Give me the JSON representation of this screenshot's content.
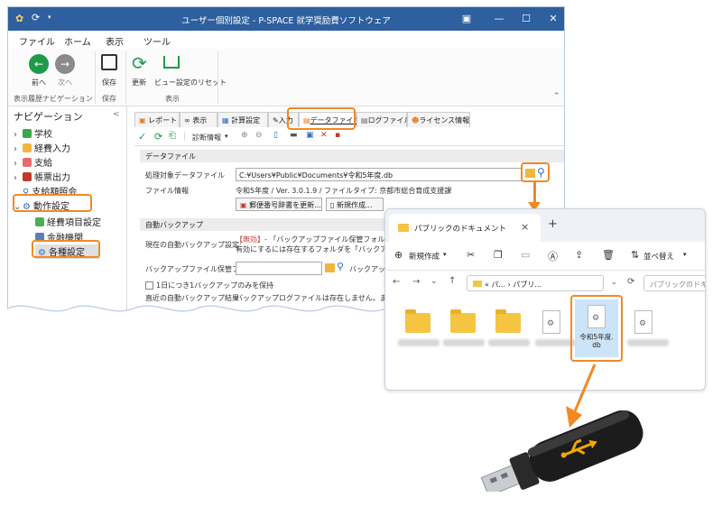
{
  "app": {
    "title": "ユーザー個別設定 - P-SPACE 就学奨励費ソフトウェア",
    "menu": [
      "ファイル",
      "ホーム",
      "表示",
      "ツール"
    ],
    "ribbon": {
      "back": "前へ",
      "forward": "次へ",
      "save": "保存",
      "refresh": "更新",
      "reset_view": "ビュー設定のリセット",
      "group_history": "表示履歴ナビゲーション",
      "group_save": "保存",
      "group_view": "表示"
    },
    "nav": {
      "title": "ナビゲーション",
      "collapse_glyph": "<",
      "items": [
        "学校",
        "経費入力",
        "支給",
        "帳票出力",
        "支給額照会",
        "動作設定",
        "経費項目設定",
        "金融機関",
        "各種設定"
      ]
    },
    "tabs": [
      "レポート",
      "表示",
      "計算設定",
      "入力",
      "データファイル",
      "ログファイル",
      "ライセンス情報"
    ],
    "toolbar": {
      "diagnose": "診断情報"
    },
    "data_section": {
      "header": "データファイル",
      "target_label": "処理対象データファイル",
      "target_path": "C:¥Users¥Public¥Documents¥令和5年度.db",
      "info_label": "ファイル情報",
      "info_value": "令和5年度 / Ver. 3.0.1.9 / ファイルタイプ: 京都市総合育成支援課",
      "btn_postal": "郵便番号辞書を更新...",
      "btn_new": "新規作成..."
    },
    "backup_section": {
      "header": "自動バックアップ",
      "status_label": "現在の自動バックアップ設定:",
      "status_invalid": "【無効】",
      "status_text1": "- 「バックアップファイル保管フォルダ」が存在して",
      "status_text2": "有効にするには存在するフォルダを「バックアップファイル",
      "folder_label": "バックアップファイル保管フォルダ",
      "folder_hint": "バックアップを作",
      "once_daily": "1日につき1バックアップのみを保持",
      "recent_label": "直近の自動バックアップ結果",
      "recent_value": "バックアップログファイルは存在しません。まだ一度もバッ"
    }
  },
  "explorer": {
    "tab_title": "パブリックのドキュメント",
    "close_glyph": "×",
    "add_glyph": "+",
    "new_label": "新規作成",
    "sort_label": "並べ替え",
    "address": "« パ... › パブリ...",
    "search_placeholder": "パブリックのドキュメントの検索",
    "selected_file": "令和5年度.db",
    "selected_file_line1": "令和5年度.",
    "selected_file_line2": "db"
  },
  "colors": {
    "titlebar": "#2e5f9e",
    "highlight": "#f08a24",
    "folder": "#f5c542",
    "usb_body": "#1c1c1c",
    "usb_logo": "#f2a900"
  }
}
